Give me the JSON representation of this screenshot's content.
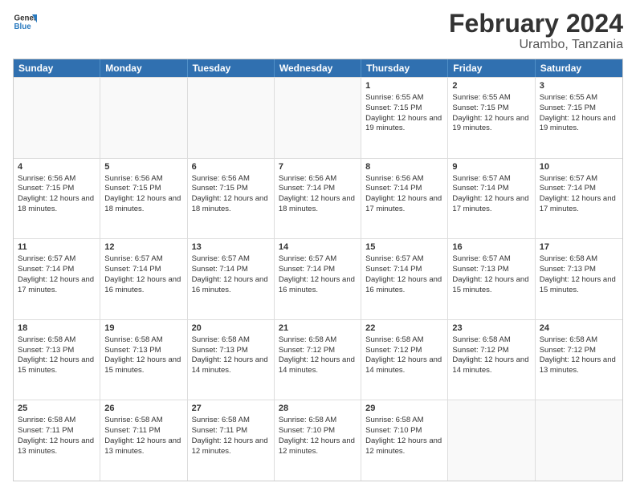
{
  "header": {
    "logo_general": "General",
    "logo_blue": "Blue",
    "month_title": "February 2024",
    "location": "Urambo, Tanzania"
  },
  "days_of_week": [
    "Sunday",
    "Monday",
    "Tuesday",
    "Wednesday",
    "Thursday",
    "Friday",
    "Saturday"
  ],
  "rows": [
    [
      {
        "day": "",
        "info": ""
      },
      {
        "day": "",
        "info": ""
      },
      {
        "day": "",
        "info": ""
      },
      {
        "day": "",
        "info": ""
      },
      {
        "day": "1",
        "info": "Sunrise: 6:55 AM\nSunset: 7:15 PM\nDaylight: 12 hours and 19 minutes."
      },
      {
        "day": "2",
        "info": "Sunrise: 6:55 AM\nSunset: 7:15 PM\nDaylight: 12 hours and 19 minutes."
      },
      {
        "day": "3",
        "info": "Sunrise: 6:55 AM\nSunset: 7:15 PM\nDaylight: 12 hours and 19 minutes."
      }
    ],
    [
      {
        "day": "4",
        "info": "Sunrise: 6:56 AM\nSunset: 7:15 PM\nDaylight: 12 hours and 18 minutes."
      },
      {
        "day": "5",
        "info": "Sunrise: 6:56 AM\nSunset: 7:15 PM\nDaylight: 12 hours and 18 minutes."
      },
      {
        "day": "6",
        "info": "Sunrise: 6:56 AM\nSunset: 7:15 PM\nDaylight: 12 hours and 18 minutes."
      },
      {
        "day": "7",
        "info": "Sunrise: 6:56 AM\nSunset: 7:14 PM\nDaylight: 12 hours and 18 minutes."
      },
      {
        "day": "8",
        "info": "Sunrise: 6:56 AM\nSunset: 7:14 PM\nDaylight: 12 hours and 17 minutes."
      },
      {
        "day": "9",
        "info": "Sunrise: 6:57 AM\nSunset: 7:14 PM\nDaylight: 12 hours and 17 minutes."
      },
      {
        "day": "10",
        "info": "Sunrise: 6:57 AM\nSunset: 7:14 PM\nDaylight: 12 hours and 17 minutes."
      }
    ],
    [
      {
        "day": "11",
        "info": "Sunrise: 6:57 AM\nSunset: 7:14 PM\nDaylight: 12 hours and 17 minutes."
      },
      {
        "day": "12",
        "info": "Sunrise: 6:57 AM\nSunset: 7:14 PM\nDaylight: 12 hours and 16 minutes."
      },
      {
        "day": "13",
        "info": "Sunrise: 6:57 AM\nSunset: 7:14 PM\nDaylight: 12 hours and 16 minutes."
      },
      {
        "day": "14",
        "info": "Sunrise: 6:57 AM\nSunset: 7:14 PM\nDaylight: 12 hours and 16 minutes."
      },
      {
        "day": "15",
        "info": "Sunrise: 6:57 AM\nSunset: 7:14 PM\nDaylight: 12 hours and 16 minutes."
      },
      {
        "day": "16",
        "info": "Sunrise: 6:57 AM\nSunset: 7:13 PM\nDaylight: 12 hours and 15 minutes."
      },
      {
        "day": "17",
        "info": "Sunrise: 6:58 AM\nSunset: 7:13 PM\nDaylight: 12 hours and 15 minutes."
      }
    ],
    [
      {
        "day": "18",
        "info": "Sunrise: 6:58 AM\nSunset: 7:13 PM\nDaylight: 12 hours and 15 minutes."
      },
      {
        "day": "19",
        "info": "Sunrise: 6:58 AM\nSunset: 7:13 PM\nDaylight: 12 hours and 15 minutes."
      },
      {
        "day": "20",
        "info": "Sunrise: 6:58 AM\nSunset: 7:13 PM\nDaylight: 12 hours and 14 minutes."
      },
      {
        "day": "21",
        "info": "Sunrise: 6:58 AM\nSunset: 7:12 PM\nDaylight: 12 hours and 14 minutes."
      },
      {
        "day": "22",
        "info": "Sunrise: 6:58 AM\nSunset: 7:12 PM\nDaylight: 12 hours and 14 minutes."
      },
      {
        "day": "23",
        "info": "Sunrise: 6:58 AM\nSunset: 7:12 PM\nDaylight: 12 hours and 14 minutes."
      },
      {
        "day": "24",
        "info": "Sunrise: 6:58 AM\nSunset: 7:12 PM\nDaylight: 12 hours and 13 minutes."
      }
    ],
    [
      {
        "day": "25",
        "info": "Sunrise: 6:58 AM\nSunset: 7:11 PM\nDaylight: 12 hours and 13 minutes."
      },
      {
        "day": "26",
        "info": "Sunrise: 6:58 AM\nSunset: 7:11 PM\nDaylight: 12 hours and 13 minutes."
      },
      {
        "day": "27",
        "info": "Sunrise: 6:58 AM\nSunset: 7:11 PM\nDaylight: 12 hours and 12 minutes."
      },
      {
        "day": "28",
        "info": "Sunrise: 6:58 AM\nSunset: 7:10 PM\nDaylight: 12 hours and 12 minutes."
      },
      {
        "day": "29",
        "info": "Sunrise: 6:58 AM\nSunset: 7:10 PM\nDaylight: 12 hours and 12 minutes."
      },
      {
        "day": "",
        "info": ""
      },
      {
        "day": "",
        "info": ""
      }
    ]
  ]
}
